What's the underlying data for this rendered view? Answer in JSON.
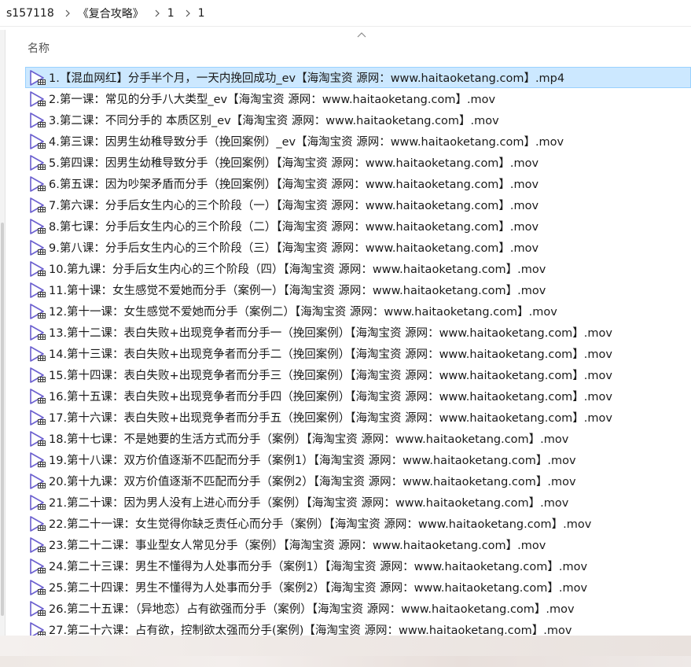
{
  "breadcrumb": [
    "s157118",
    "《复合攻略》",
    "1",
    "1"
  ],
  "column_header": "名称",
  "files": [
    "1.【混血网红】分手半个月，一天内挽回成功_ev【海淘宝资 源网：www.haitaoketang.com】.mp4",
    "2.第一课：常见的分手八大类型_ev【海淘宝资 源网：www.haitaoketang.com】.mov",
    "3.第二课：不同分手的 本质区别_ev【海淘宝资 源网：www.haitaoketang.com】.mov",
    "4.第三课：因男生幼稚导致分手（挽回案例）_ev【海淘宝资 源网：www.haitaoketang.com】.mov",
    "5.第四课：因男生幼稚导致分手（挽回案例）【海淘宝资 源网：www.haitaoketang.com】.mov",
    "6.第五课：因为吵架矛盾而分手（挽回案例）【海淘宝资 源网：www.haitaoketang.com】.mov",
    "7.第六课：分手后女生内心的三个阶段（一）【海淘宝资 源网：www.haitaoketang.com】.mov",
    "8.第七课：分手后女生内心的三个阶段（二）【海淘宝资 源网：www.haitaoketang.com】.mov",
    "9.第八课：分手后女生内心的三个阶段（三）【海淘宝资 源网：www.haitaoketang.com】.mov",
    "10.第九课：分手后女生内心的三个阶段（四）【海淘宝资 源网：www.haitaoketang.com】.mov",
    "11.第十课：女生感觉不爱她而分手（案例一）【海淘宝资 源网：www.haitaoketang.com】.mov",
    "12.第十一课：女生感觉不爱她而分手（案例二）【海淘宝资 源网：www.haitaoketang.com】.mov",
    "13.第十二课：表白失败+出现竞争者而分手一（挽回案例）【海淘宝资 源网：www.haitaoketang.com】.mov",
    "14.第十三课：表白失败+出现竞争者而分手二（挽回案例）【海淘宝资 源网：www.haitaoketang.com】.mov",
    "15.第十四课：表白失败+出现竞争者而分手三（挽回案例）【海淘宝资 源网：www.haitaoketang.com】.mov",
    "16.第十五课：表白失败+出现竞争者而分手四（挽回案例）【海淘宝资 源网：www.haitaoketang.com】.mov",
    "17.第十六课：表白失败+出现竞争者而分手五（挽回案例）【海淘宝资 源网：www.haitaoketang.com】.mov",
    "18.第十七课：不是她要的生活方式而分手（案例）【海淘宝资 源网：www.haitaoketang.com】.mov",
    "19.第十八课：双方价值逐渐不匹配而分手（案例1）【海淘宝资 源网：www.haitaoketang.com】.mov",
    "20.第十九课：双方价值逐渐不匹配而分手（案例2）【海淘宝资 源网：www.haitaoketang.com】.mov",
    "21.第二十课：因为男人没有上进心而分手（案例）【海淘宝资 源网：www.haitaoketang.com】.mov",
    "22.第二十一课：女生觉得你缺乏责任心而分手（案例）【海淘宝资 源网：www.haitaoketang.com】.mov",
    "23.第二十二课：事业型女人常见分手（案例）【海淘宝资 源网：www.haitaoketang.com】.mov",
    "24.第二十三课：男生不懂得为人处事而分手（案例1）【海淘宝资 源网：www.haitaoketang.com】.mov",
    "25.第二十四课：男生不懂得为人处事而分手（案例2）【海淘宝资 源网：www.haitaoketang.com】.mov",
    "26.第二十五课：（异地恋）占有欲强而分手（案例）【海淘宝资 源网：www.haitaoketang.com】.mov",
    "27.第二十六课：占有欲，控制欲太强而分手(案例)【海淘宝资 源网：www.haitaoketang.com】.mov"
  ],
  "selected_index": 0,
  "icon": "video-file-icon",
  "colors": {
    "selected_bg": "#cce8ff",
    "selected_border": "#99d1ff",
    "icon_accent": "#6b5fcf"
  }
}
